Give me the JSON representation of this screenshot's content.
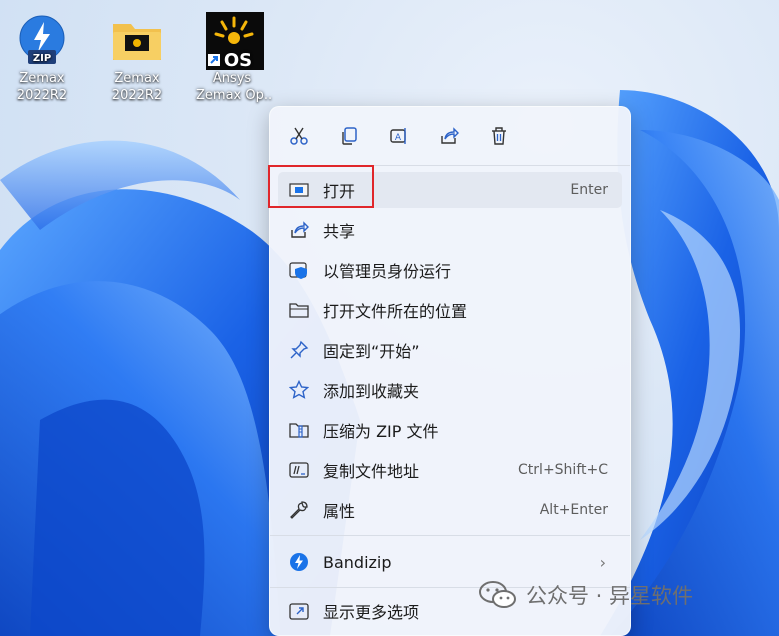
{
  "desktop": {
    "icons": [
      {
        "label_line1": "Zemax",
        "label_line2": "2022R2",
        "badge": "ZIP",
        "icon": "bandizip-archive-icon"
      },
      {
        "label_line1": "Zemax",
        "label_line2": "2022R2",
        "icon": "folder-icon"
      },
      {
        "label_line1": "Ansys",
        "label_line2": "Zemax Op..",
        "badge": "OS",
        "icon": "opticstudio-shortcut-icon"
      }
    ]
  },
  "context_menu": {
    "quick_actions": [
      {
        "name": "cut",
        "icon": "scissors-icon"
      },
      {
        "name": "copy",
        "icon": "copy-icon"
      },
      {
        "name": "rename",
        "icon": "rename-icon"
      },
      {
        "name": "share",
        "icon": "share-icon"
      },
      {
        "name": "delete",
        "icon": "trash-icon"
      }
    ],
    "items": [
      {
        "label": "打开",
        "shortcut": "Enter",
        "icon": "open-window-icon"
      },
      {
        "label": "共享",
        "shortcut": "",
        "icon": "share-icon"
      },
      {
        "label": "以管理员身份运行",
        "shortcut": "",
        "icon": "shield-icon"
      },
      {
        "label": "打开文件所在的位置",
        "shortcut": "",
        "icon": "folder-icon"
      },
      {
        "label": "固定到“开始”",
        "shortcut": "",
        "icon": "pin-icon"
      },
      {
        "label": "添加到收藏夹",
        "shortcut": "",
        "icon": "star-icon"
      },
      {
        "label": "压缩为 ZIP 文件",
        "shortcut": "",
        "icon": "zip-folder-icon"
      },
      {
        "label": "复制文件地址",
        "shortcut": "Ctrl+Shift+C",
        "icon": "copy-path-icon"
      },
      {
        "label": "属性",
        "shortcut": "Alt+Enter",
        "icon": "wrench-icon"
      },
      {
        "label": "Bandizip",
        "shortcut": "",
        "icon": "bandizip-icon"
      },
      {
        "label": "显示更多选项",
        "shortcut": "",
        "icon": "more-options-icon"
      }
    ],
    "bandizip_submenu_arrow": "›"
  },
  "watermark": {
    "text": "公众号 · 异星软件",
    "icon": "wechat-icon"
  },
  "colors": {
    "accent": "#1a73e8",
    "highlight_box": "#e0262a",
    "wallpaper_blue": "#0a5fd6"
  }
}
